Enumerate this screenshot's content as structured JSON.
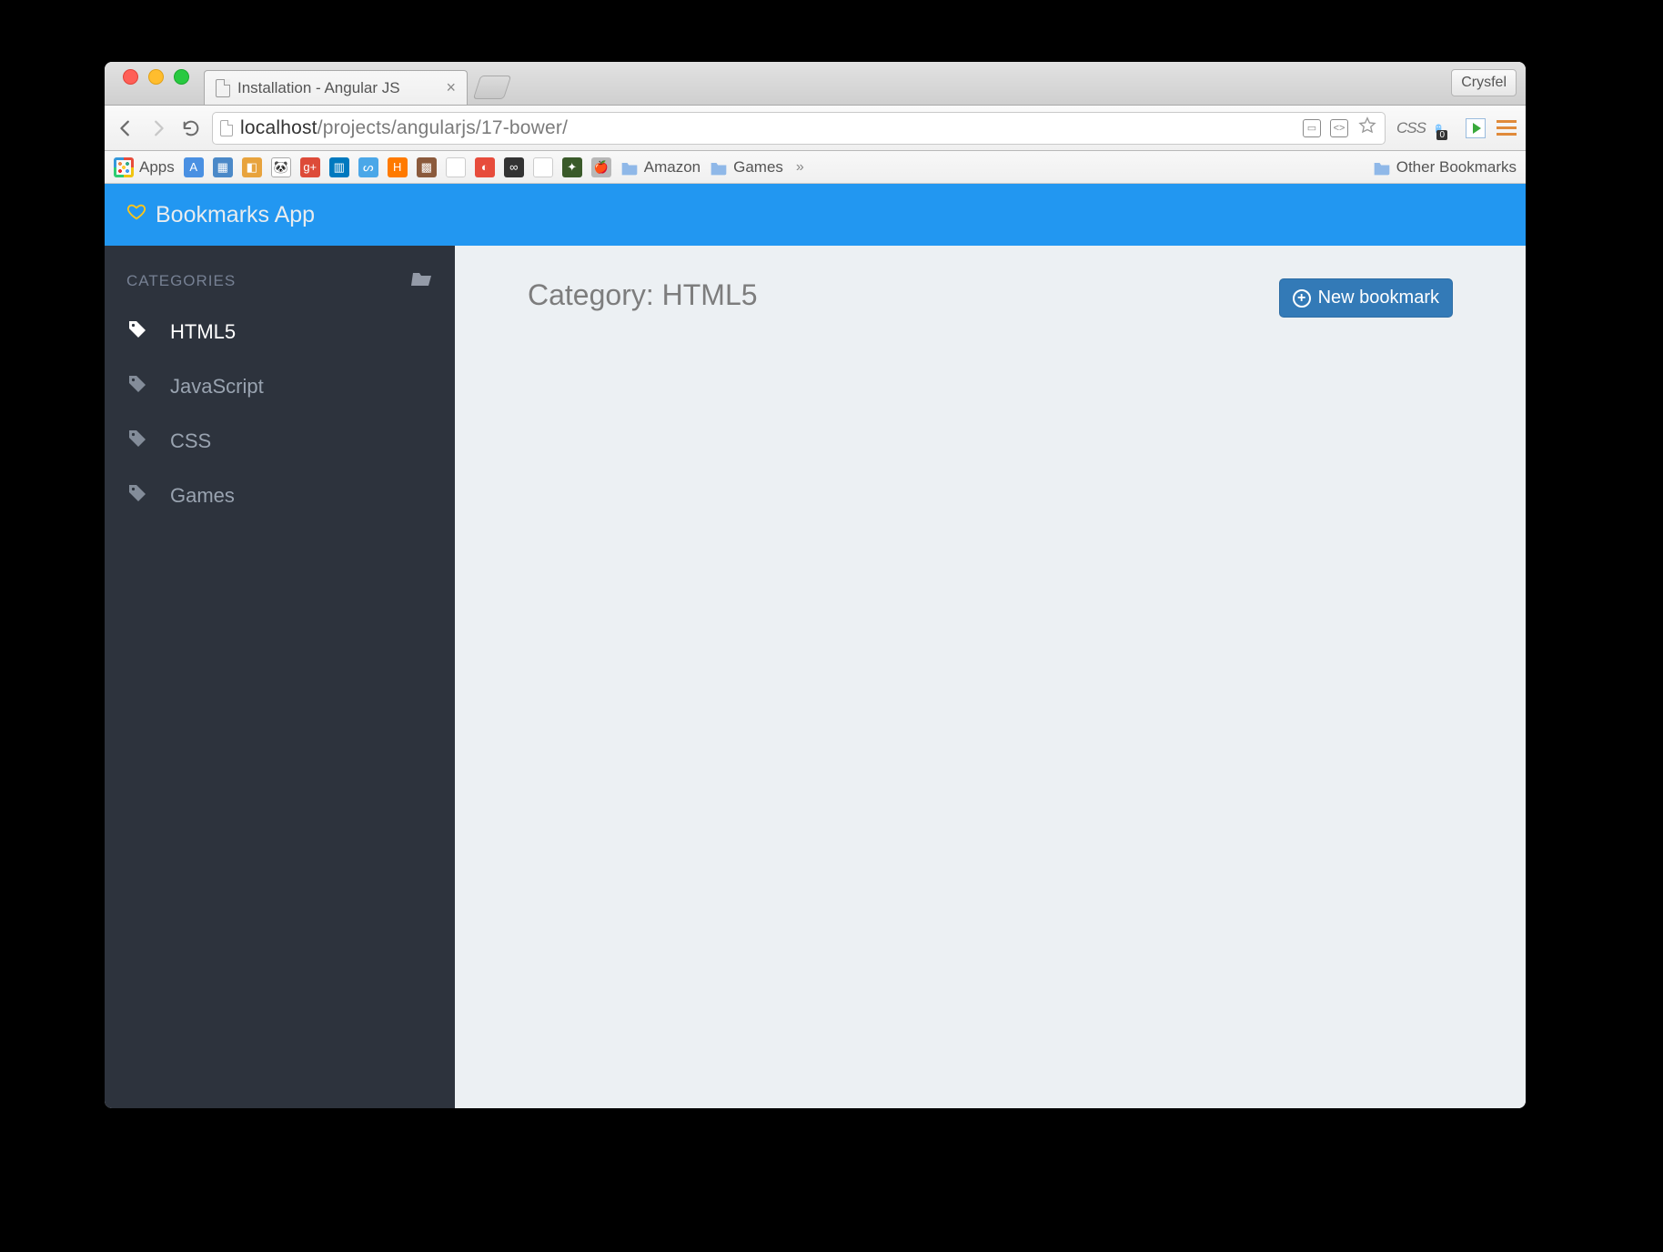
{
  "browser": {
    "tab_title": "Installation - Angular JS",
    "profile_name": "Crysfel",
    "url_host": "localhost",
    "url_path": "/projects/angularjs/17-bower/",
    "bookmarks_bar": {
      "apps_label": "Apps",
      "folders": [
        "Amazon",
        "Games"
      ],
      "other_label": "Other Bookmarks"
    },
    "ext_css_label": "CSS"
  },
  "app": {
    "brand": "Bookmarks App",
    "sidebar_title": "CATEGORIES",
    "categories": [
      {
        "label": "HTML5",
        "active": true
      },
      {
        "label": "JavaScript",
        "active": false
      },
      {
        "label": "CSS",
        "active": false
      },
      {
        "label": "Games",
        "active": false
      }
    ],
    "page_title_prefix": "Category: ",
    "current_category": "HTML5",
    "new_bookmark_label": "New bookmark"
  }
}
